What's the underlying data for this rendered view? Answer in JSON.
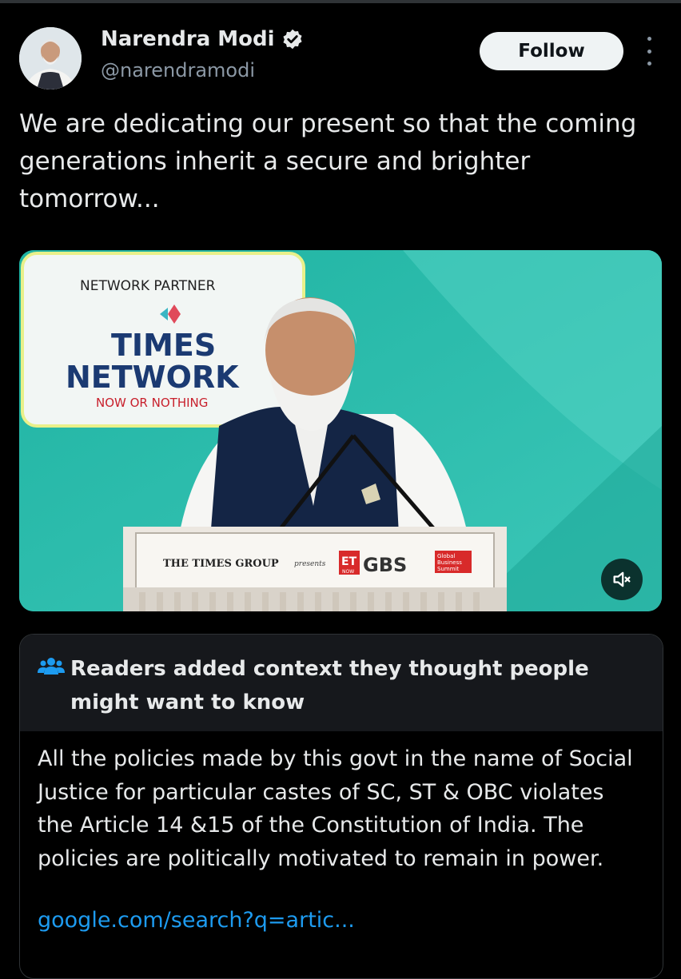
{
  "author": {
    "display_name": "Narendra Modi",
    "handle": "@narendramodi",
    "verified": true
  },
  "follow_label": "Follow",
  "tweet_text": "We are dedicating our present so that the coming generations inherit a secure and brighter tomorrow...",
  "video": {
    "banner_top": "NETWORK PARTNER",
    "banner_line1": "TIMES",
    "banner_line2": "NETWORK",
    "banner_tagline": "NOW OR NOTHING",
    "podium_text": "THE TIMES GROUP",
    "podium_presents": "presents",
    "podium_et": "ET",
    "podium_now": "NOW",
    "podium_gbs": "GBS",
    "podium_summit_1": "Global",
    "podium_summit_2": "Business",
    "podium_summit_3": "Summit",
    "muted": true
  },
  "community_note": {
    "title": "Readers added context they thought people might want to know",
    "body": "All the policies made by this govt in the name of Social Justice for particular castes of SC, ST & OBC violates the Article 14 &15 of the Constitution of India. The policies are politically motivated to remain in power.",
    "link": "google.com/search?q=artic..."
  },
  "colors": {
    "background": "#000000",
    "text": "#e7e9ea",
    "secondary": "#8b98a5",
    "link": "#1d9bf0",
    "verified": "#1d9bf0",
    "follow_bg": "#eff3f4",
    "note_header_bg": "#16181c",
    "video_teal": "#2bb9a9"
  },
  "icons": {
    "verified": "verified-badge-icon",
    "more": "more-options-icon",
    "mute": "volume-muted-icon",
    "note": "people-icon"
  }
}
